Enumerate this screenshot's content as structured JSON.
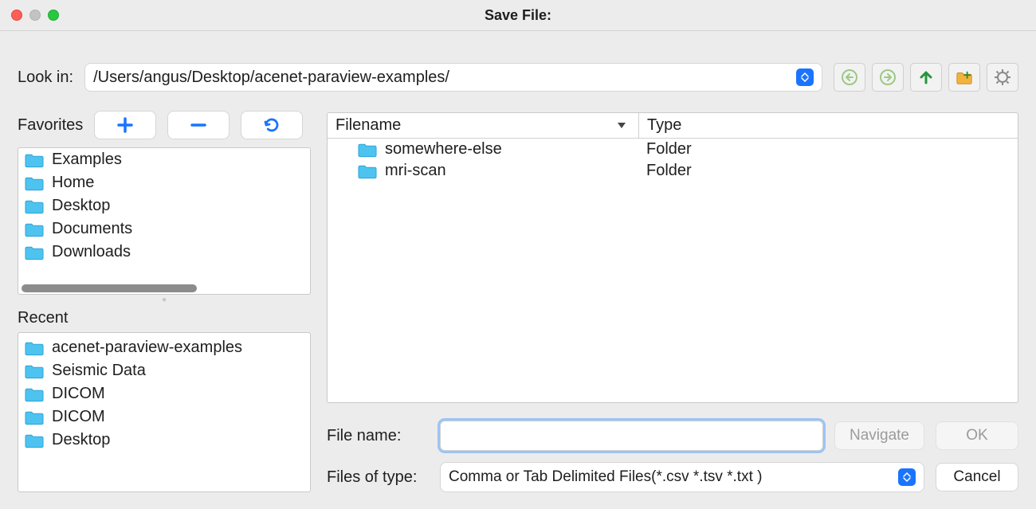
{
  "window": {
    "title": "Save File:"
  },
  "lookin": {
    "label": "Look in:",
    "path": "/Users/angus/Desktop/acenet-paraview-examples/"
  },
  "favorites": {
    "label": "Favorites",
    "items": [
      "Examples",
      "Home",
      "Desktop",
      "Documents",
      "Downloads"
    ]
  },
  "recent": {
    "label": "Recent",
    "items": [
      "acenet-paraview-examples",
      "Seismic Data",
      "DICOM",
      "DICOM",
      "Desktop"
    ]
  },
  "filelist": {
    "headers": {
      "filename": "Filename",
      "type": "Type"
    },
    "rows": [
      {
        "name": "somewhere-else",
        "type": "Folder"
      },
      {
        "name": "mri-scan",
        "type": "Folder"
      }
    ]
  },
  "form": {
    "filename_label": "File name:",
    "filename_value": "",
    "filetype_label": "Files of type:",
    "filetype_value": "Comma or Tab Delimited Files(*.csv *.tsv *.txt )"
  },
  "buttons": {
    "navigate": "Navigate",
    "ok": "OK",
    "cancel": "Cancel"
  },
  "icons": {
    "add": "+",
    "remove": "−",
    "refresh": "⟳"
  },
  "colors": {
    "accent": "#1a74ff",
    "folder": "#29b1e8"
  }
}
